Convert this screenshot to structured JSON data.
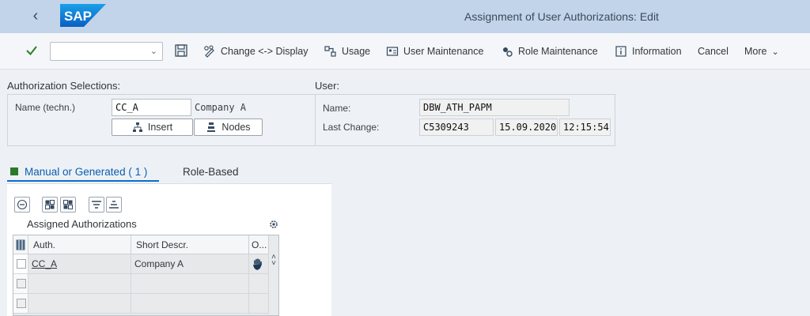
{
  "shell": {
    "logo_text": "SAP",
    "title": "Assignment of User Authorizations: Edit"
  },
  "toolbar": {
    "change_display": "Change <-> Display",
    "usage": "Usage",
    "user_maintenance": "User Maintenance",
    "role_maintenance": "Role Maintenance",
    "information": "Information",
    "cancel": "Cancel",
    "more": "More"
  },
  "auth_selection": {
    "title": "Authorization Selections:",
    "name_label": "Name (techn.)",
    "name_value": "CC_A",
    "name_desc": "Company A",
    "insert_label": "Insert",
    "nodes_label": "Nodes"
  },
  "user": {
    "title": "User:",
    "name_label": "Name:",
    "name_value": "DBW_ATH_PAPM",
    "last_change_label": "Last Change:",
    "changed_by": "C5309243",
    "date": "15.09.2020",
    "time": "12:15:54"
  },
  "tabs": {
    "manual": "Manual or Generated ( 1 )",
    "role_based": "Role-Based"
  },
  "assigned": {
    "title": "Assigned Authorizations",
    "columns": {
      "auth": "Auth.",
      "short_descr": "Short Descr.",
      "other": "O..."
    },
    "rows": [
      {
        "auth": "CC_A",
        "descr": "Company A"
      }
    ]
  },
  "colors": {
    "shell_bg": "#c2d4ea",
    "accent": "#0a6ed1",
    "check": "#2b7d2b"
  }
}
